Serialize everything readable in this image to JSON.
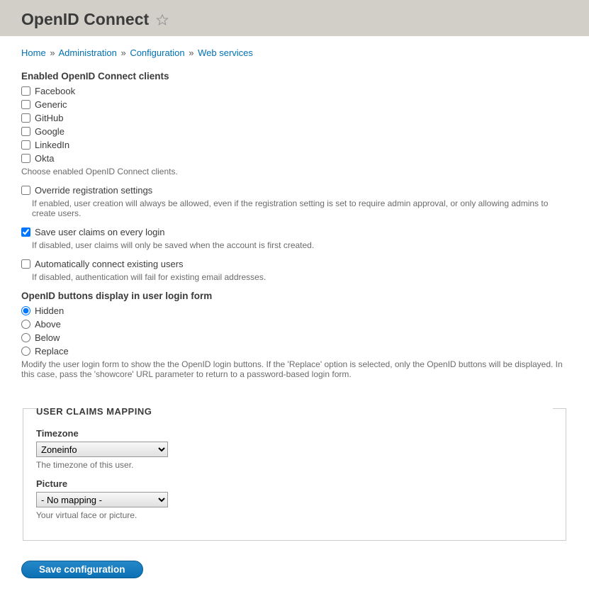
{
  "header": {
    "title": "OpenID Connect"
  },
  "breadcrumb": {
    "home": "Home",
    "admin": "Administration",
    "config": "Configuration",
    "web": "Web services"
  },
  "clients": {
    "label": "Enabled OpenID Connect clients",
    "items": [
      "Facebook",
      "Generic",
      "GitHub",
      "Google",
      "LinkedIn",
      "Okta"
    ],
    "help": "Choose enabled OpenID Connect clients."
  },
  "override": {
    "label": "Override registration settings",
    "help": "If enabled, user creation will always be allowed, even if the registration setting is set to require admin approval, or only allowing admins to create users."
  },
  "save_claims": {
    "label": "Save user claims on every login",
    "help": "If disabled, user claims will only be saved when the account is first created."
  },
  "auto_connect": {
    "label": "Automatically connect existing users",
    "help": "If disabled, authentication will fail for existing email addresses."
  },
  "buttons_display": {
    "label": "OpenID buttons display in user login form",
    "options": [
      "Hidden",
      "Above",
      "Below",
      "Replace"
    ],
    "help": "Modify the user login form to show the the OpenID login buttons. If the 'Replace' option is selected, only the OpenID buttons will be displayed. In this case, pass the 'showcore' URL parameter to return to a password-based login form."
  },
  "claims_mapping": {
    "legend": "USER CLAIMS MAPPING",
    "timezone": {
      "label": "Timezone",
      "value": "Zoneinfo",
      "help": "The timezone of this user."
    },
    "picture": {
      "label": "Picture",
      "value": "- No mapping -",
      "help": "Your virtual face or picture."
    }
  },
  "submit": {
    "label": "Save configuration"
  }
}
